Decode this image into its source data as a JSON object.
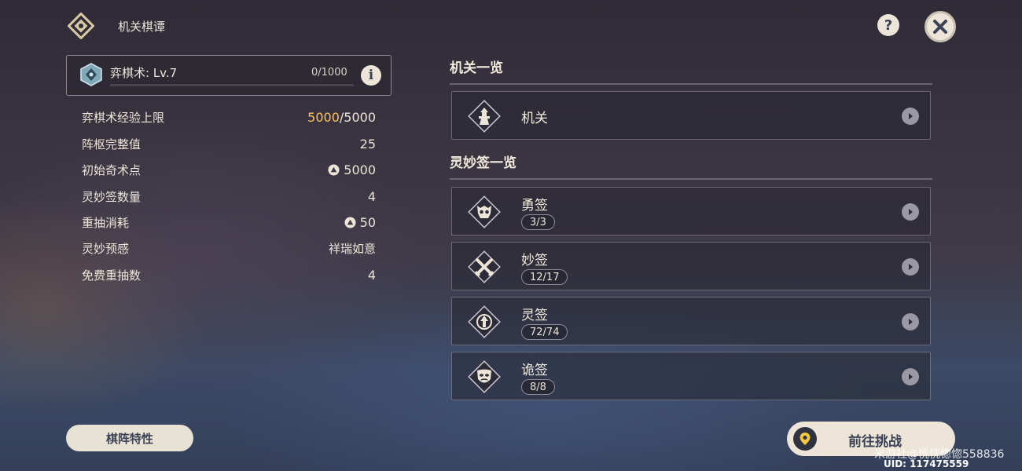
{
  "header": {
    "title": "机关棋谭",
    "logo_icon": "diamond-emblem-icon",
    "help_label": "?",
    "help_icon": "question-icon",
    "close_icon": "close-x-icon"
  },
  "level": {
    "label": "弈棋术: Lv.7",
    "progress": "0/1000",
    "progress_fraction": 0,
    "icon": "chess-gem-icon",
    "info_label": "i"
  },
  "stats": [
    {
      "label": "弈棋术经验上限",
      "value_highlight": "5000",
      "value": "/5000"
    },
    {
      "label": "阵枢完整值",
      "value": "25"
    },
    {
      "label": "初始奇术点",
      "value": "5000",
      "icon": "coin-icon"
    },
    {
      "label": "灵妙签数量",
      "value": "4"
    },
    {
      "label": "重抽消耗",
      "value": "50",
      "icon": "coin-icon"
    },
    {
      "label": "灵妙预感",
      "value": "祥瑞如意"
    },
    {
      "label": "免费重抽数",
      "value": "4"
    }
  ],
  "bottom_left_button": "棋阵特性",
  "mechanisms": {
    "title": "机关一览",
    "items": [
      {
        "name": "机关",
        "icon": "tower-icon"
      }
    ]
  },
  "cards": {
    "title": "灵妙签一览",
    "items": [
      {
        "name": "勇签",
        "count": "3/3",
        "icon": "skull-icon"
      },
      {
        "name": "妙签",
        "count": "12/17",
        "icon": "crossed-swords-icon"
      },
      {
        "name": "灵签",
        "count": "72/74",
        "icon": "arrow-up-icon"
      },
      {
        "name": "诡签",
        "count": "8/8",
        "icon": "mask-icon"
      }
    ]
  },
  "go_button": {
    "label": "前往挑战",
    "icon": "map-pin-icon"
  },
  "watermark": "米游社@恍恍惚惚558836",
  "uid": "UID: 117475559",
  "colors": {
    "accent": "#ffc15a",
    "light": "#ece5d8",
    "dark_text": "#3b4255"
  }
}
